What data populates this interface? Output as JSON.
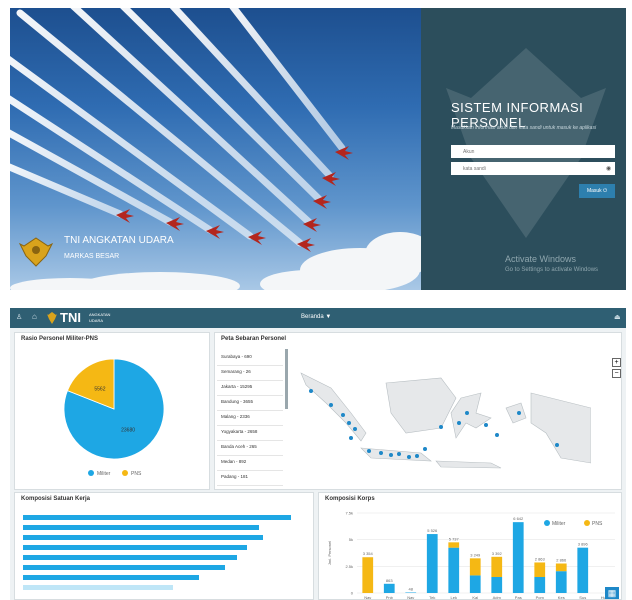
{
  "login": {
    "brand_title": "TNI ANGKATAN UDARA",
    "brand_subtitle": "MARKAS BESAR",
    "panel_title": "SISTEM INFORMASI PERSONEL",
    "panel_subtitle": "Masukkan informasi akun dan kata sandi untuk masuk ke aplikasi",
    "username_placeholder": "Akun",
    "password_placeholder": "kata sandi",
    "submit_label": "Masuk",
    "activate_line1": "Activate Windows",
    "activate_line2": "Go to Settings to activate Windows"
  },
  "dashboard": {
    "logo_text": "TNI",
    "logo_sub1": "ANGKATAN",
    "logo_sub2": "UDARA",
    "nav_menu": "Beranda ▼",
    "ratio_card": {
      "title": "Rasio Personel Militer-PNS",
      "legend_militer": "Militer",
      "legend_pns": "PNS"
    },
    "map_card": {
      "title": "Peta Sebaran Personel",
      "zoom_in": "+",
      "zoom_out": "−",
      "cities": [
        "Surabaya - 690",
        "Semarang - 26",
        "Jakarta - 15295",
        "Bandung - 3655",
        "Malang - 2336",
        "Yogyakarta - 2658",
        "Banda Aceh - 265",
        "Medan - 892",
        "Padang - 181"
      ]
    },
    "satuan_card": {
      "title": "Komposisi Satuan Kerja"
    },
    "korps_card": {
      "title": "Komposisi Korps"
    }
  },
  "chart_data": [
    {
      "type": "pie",
      "title": "Rasio Personel Militer-PNS",
      "categories": [
        "Militer",
        "PNS"
      ],
      "values": [
        23680,
        5562
      ],
      "labels": [
        "23680",
        "5562"
      ],
      "colors": [
        "#1ea7e4",
        "#f5b814"
      ]
    },
    {
      "type": "bar",
      "title": "Komposisi Korps",
      "ylabel": "Jml. Personel",
      "ylim": [
        0,
        7500
      ],
      "yticks": [
        "0",
        "2.5k",
        "5k",
        "7.5k"
      ],
      "categories": [
        "Nav",
        "Pnb",
        "Nav",
        "Tek",
        "Lek",
        "Kal",
        "Adm",
        "Pas",
        "Pom",
        "Kes",
        "Sus",
        "Huk"
      ],
      "series": [
        {
          "name": "Militer",
          "color": "#1ea7e4",
          "values": [
            0,
            863,
            48,
            5526,
            4250,
            1650,
            1500,
            6642,
            1500,
            2046,
            4250,
            0
          ],
          "labels": [
            "",
            "863",
            "48",
            "5 526",
            "",
            "",
            "",
            "6 642",
            "",
            "",
            "",
            ""
          ]
        },
        {
          "name": "PNS",
          "color": "#f5b814",
          "values": [
            3354,
            0,
            0,
            0,
            500,
            1600,
            1892,
            0,
            1363,
            720,
            0,
            0
          ],
          "labels": [
            "3 354",
            "",
            "",
            "",
            "5 737",
            "3 249",
            "3 392",
            "",
            "2 863",
            "2 866",
            "3 896",
            ""
          ]
        }
      ]
    }
  ]
}
